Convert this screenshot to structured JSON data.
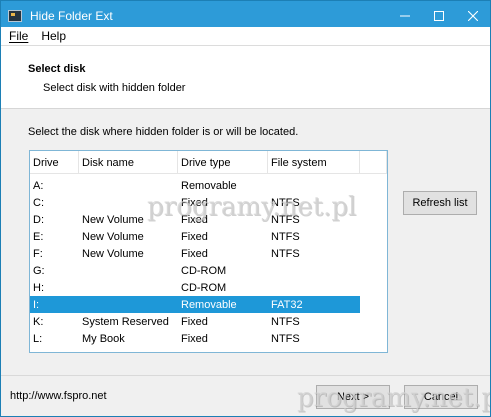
{
  "window": {
    "title": "Hide Folder Ext"
  },
  "menu": {
    "file": "File",
    "help": "Help"
  },
  "header": {
    "title": "Select disk",
    "subtitle": "Select disk with hidden folder"
  },
  "instruction": "Select the disk where hidden folder is or will be located.",
  "table": {
    "columns": [
      "Drive",
      "Disk name",
      "Drive type",
      "File system"
    ],
    "rows": [
      {
        "drive": "A:",
        "name": "",
        "type": "Removable",
        "fs": ""
      },
      {
        "drive": "C:",
        "name": "",
        "type": "Fixed",
        "fs": "NTFS"
      },
      {
        "drive": "D:",
        "name": "New Volume",
        "type": "Fixed",
        "fs": "NTFS"
      },
      {
        "drive": "E:",
        "name": "New Volume",
        "type": "Fixed",
        "fs": "NTFS"
      },
      {
        "drive": "F:",
        "name": "New Volume",
        "type": "Fixed",
        "fs": "NTFS"
      },
      {
        "drive": "G:",
        "name": "",
        "type": "CD-ROM",
        "fs": ""
      },
      {
        "drive": "H:",
        "name": "",
        "type": "CD-ROM",
        "fs": ""
      },
      {
        "drive": "I:",
        "name": "",
        "type": "Removable",
        "fs": "FAT32",
        "selected": true
      },
      {
        "drive": "K:",
        "name": "System Reserved",
        "type": "Fixed",
        "fs": "NTFS"
      },
      {
        "drive": "L:",
        "name": "My Book",
        "type": "Fixed",
        "fs": "NTFS"
      }
    ]
  },
  "buttons": {
    "refresh": "Refresh list",
    "next": "Next >",
    "cancel": "Cancel"
  },
  "footer": {
    "link": "http://www.fspro.net"
  },
  "watermark": {
    "text": "programy.net.pl"
  },
  "colors": {
    "titlebar": "#2d9bd8",
    "selection": "#1e98d8",
    "list_border": "#7fb6d6"
  }
}
